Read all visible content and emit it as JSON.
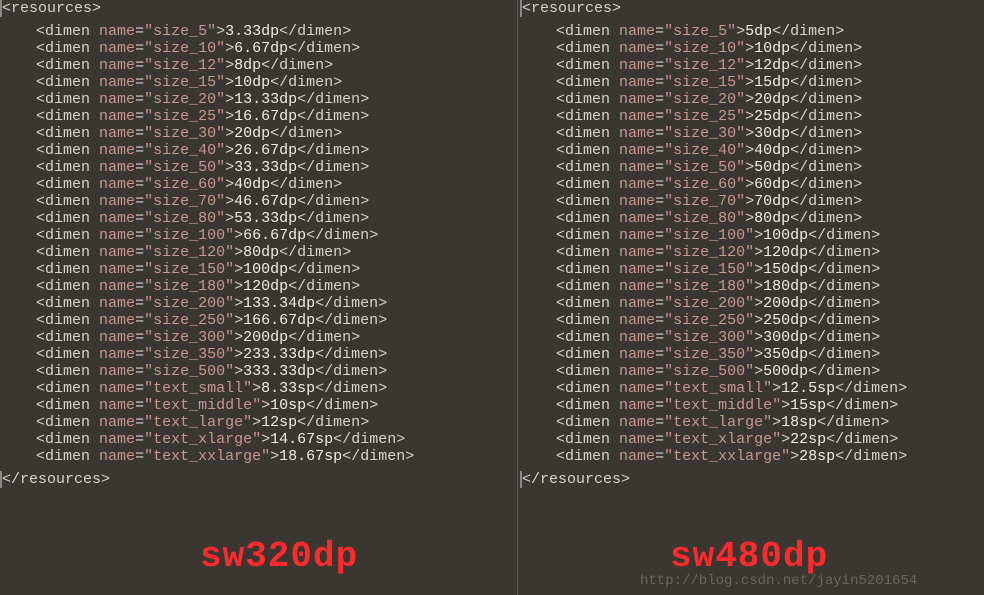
{
  "left": {
    "root_open": "<resources>",
    "root_close": "</resources>",
    "overlay": "sw320dp",
    "rows": [
      {
        "name": "size_5",
        "value": "3.33dp"
      },
      {
        "name": "size_10",
        "value": "6.67dp"
      },
      {
        "name": "size_12",
        "value": "8dp"
      },
      {
        "name": "size_15",
        "value": "10dp"
      },
      {
        "name": "size_20",
        "value": "13.33dp"
      },
      {
        "name": "size_25",
        "value": "16.67dp"
      },
      {
        "name": "size_30",
        "value": "20dp"
      },
      {
        "name": "size_40",
        "value": "26.67dp"
      },
      {
        "name": "size_50",
        "value": "33.33dp"
      },
      {
        "name": "size_60",
        "value": "40dp"
      },
      {
        "name": "size_70",
        "value": "46.67dp"
      },
      {
        "name": "size_80",
        "value": "53.33dp"
      },
      {
        "name": "size_100",
        "value": "66.67dp"
      },
      {
        "name": "size_120",
        "value": "80dp"
      },
      {
        "name": "size_150",
        "value": "100dp"
      },
      {
        "name": "size_180",
        "value": "120dp"
      },
      {
        "name": "size_200",
        "value": "133.34dp"
      },
      {
        "name": "size_250",
        "value": "166.67dp"
      },
      {
        "name": "size_300",
        "value": "200dp"
      },
      {
        "name": "size_350",
        "value": "233.33dp"
      },
      {
        "name": "size_500",
        "value": "333.33dp"
      },
      {
        "name": "text_small",
        "value": "8.33sp"
      },
      {
        "name": "text_middle",
        "value": "10sp"
      },
      {
        "name": "text_large",
        "value": "12sp"
      },
      {
        "name": "text_xlarge",
        "value": "14.67sp"
      },
      {
        "name": "text_xxlarge",
        "value": "18.67sp"
      }
    ]
  },
  "right": {
    "root_open": "<resources>",
    "root_close": "</resources>",
    "overlay": "sw480dp",
    "rows": [
      {
        "name": "size_5",
        "value": "5dp"
      },
      {
        "name": "size_10",
        "value": "10dp"
      },
      {
        "name": "size_12",
        "value": "12dp"
      },
      {
        "name": "size_15",
        "value": "15dp"
      },
      {
        "name": "size_20",
        "value": "20dp"
      },
      {
        "name": "size_25",
        "value": "25dp"
      },
      {
        "name": "size_30",
        "value": "30dp"
      },
      {
        "name": "size_40",
        "value": "40dp"
      },
      {
        "name": "size_50",
        "value": "50dp"
      },
      {
        "name": "size_60",
        "value": "60dp"
      },
      {
        "name": "size_70",
        "value": "70dp"
      },
      {
        "name": "size_80",
        "value": "80dp"
      },
      {
        "name": "size_100",
        "value": "100dp"
      },
      {
        "name": "size_120",
        "value": "120dp"
      },
      {
        "name": "size_150",
        "value": "150dp"
      },
      {
        "name": "size_180",
        "value": "180dp"
      },
      {
        "name": "size_200",
        "value": "200dp"
      },
      {
        "name": "size_250",
        "value": "250dp"
      },
      {
        "name": "size_300",
        "value": "300dp"
      },
      {
        "name": "size_350",
        "value": "350dp"
      },
      {
        "name": "size_500",
        "value": "500dp"
      },
      {
        "name": "text_small",
        "value": "12.5sp"
      },
      {
        "name": "text_middle",
        "value": "15sp"
      },
      {
        "name": "text_large",
        "value": "18sp"
      },
      {
        "name": "text_xlarge",
        "value": "22sp"
      },
      {
        "name": "text_xxlarge",
        "value": "28sp"
      }
    ]
  },
  "watermark": "http://blog.csdn.net/jayin5201654"
}
